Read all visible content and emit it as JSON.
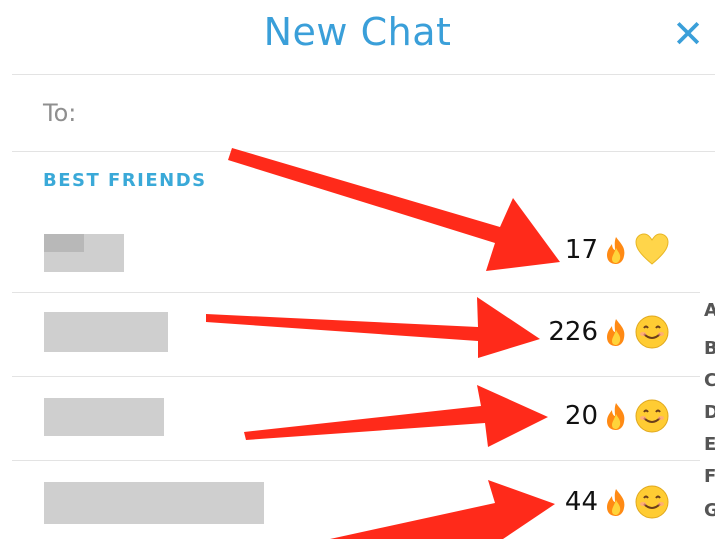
{
  "header": {
    "title": "New Chat",
    "close_icon": "close-x-icon"
  },
  "to": {
    "label": "To:"
  },
  "section": {
    "title": "BEST FRIENDS"
  },
  "friends": [
    {
      "streak": "17",
      "streak_icon": "fire-icon",
      "status_icon": "yellow-heart-icon"
    },
    {
      "streak": "226",
      "streak_icon": "fire-icon",
      "status_icon": "smiling-face-icon"
    },
    {
      "streak": "20",
      "streak_icon": "fire-icon",
      "status_icon": "smiling-face-icon"
    },
    {
      "streak": "44",
      "streak_icon": "fire-icon",
      "status_icon": "smiling-face-icon"
    }
  ],
  "alphabet_index": [
    "A",
    "B",
    "C",
    "D",
    "E",
    "F",
    "G"
  ],
  "colors": {
    "accent": "#3a9fd9",
    "arrow": "#ff2a1a",
    "section": "#3aa9d8"
  }
}
